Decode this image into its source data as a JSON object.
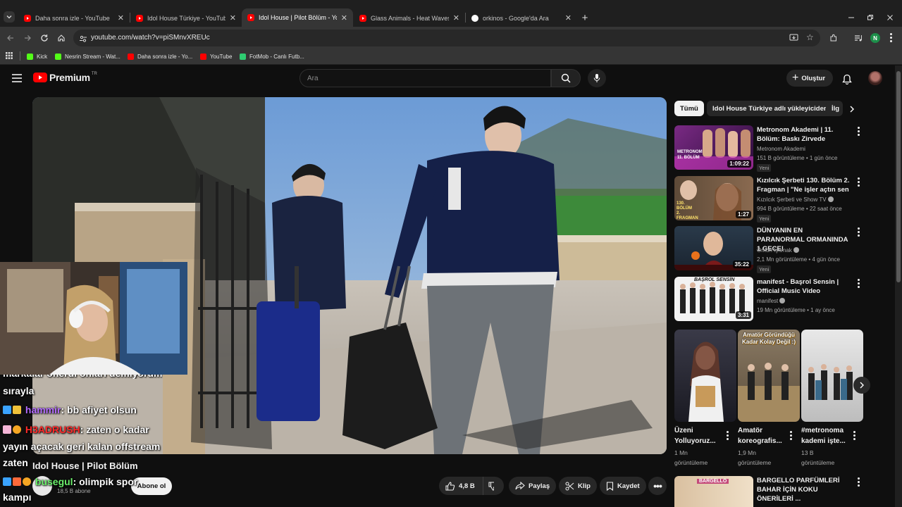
{
  "browser": {
    "tabs": [
      {
        "title": "Daha sonra izle - YouTube",
        "icon": "youtube-icon"
      },
      {
        "title": "Idol House Türkiye - YouTube",
        "icon": "youtube-icon"
      },
      {
        "title": "Idol House | Pilot Bölüm - YouT",
        "icon": "youtube-icon",
        "active": true
      },
      {
        "title": "Glass Animals - Heat Waves (Of",
        "icon": "youtube-icon"
      },
      {
        "title": "orkinos - Google'da Ara",
        "icon": "google-icon"
      }
    ],
    "url": "youtube.com/watch?v=piSMnvXREUc",
    "profile_initial": "N",
    "bookmarks": [
      {
        "label": "Kick",
        "color": "#53fc18"
      },
      {
        "label": "Nesrin Stream - Wat...",
        "color": "#53fc18"
      },
      {
        "label": "Daha sonra izle - Yo...",
        "color": "#ff0000"
      },
      {
        "label": "YouTube",
        "color": "#ff0000"
      },
      {
        "label": "FotMob - Canlı Futb...",
        "color": "#2ecc71"
      }
    ]
  },
  "youtube": {
    "logo_text": "Premium",
    "logo_sup": "TR",
    "search_placeholder": "Ara",
    "create_label": "Oluştur",
    "video": {
      "title": "Idol House | Pilot Bölüm",
      "channel_subs": "18,5 B abone",
      "subscribe_label": "Abone ol",
      "likes": "4,8 B",
      "share_label": "Paylaş",
      "clip_label": "Klip",
      "save_label": "Kaydet"
    },
    "chips": [
      "Tümü",
      "Idol House Türkiye adlı yükleyiciden",
      "İlg"
    ],
    "recommendations": [
      {
        "title": "Metronom Akademi | 11. Bölüm: Baskı Zirvede",
        "channel": "Metronom Akademi",
        "meta": "151 B görüntüleme • 1 gün önce",
        "badge": "Yeni",
        "duration": "1:09:22"
      },
      {
        "title": "Kızılcık Şerbeti 130. Bölüm 2. Fragman | \"Ne işler açtın sen ...",
        "channel": "Kızılcık Şerbeti ve Show TV",
        "meta": "994 B görüntüleme • 22 saat önce",
        "badge": "Yeni",
        "duration": "1:27"
      },
      {
        "title": "DÜNYANIN EN PARANORMAL ORMANINDA 1 GECE!",
        "channel": "Orkun Işıtmak",
        "meta": "2,1 Mn görüntüleme • 4 gün önce",
        "badge": "Yeni",
        "duration": "35:22"
      },
      {
        "title": "manifest - Başrol Sensin | Official Music Video",
        "channel": "manifest",
        "meta": "19 Mn görüntüleme • 1 ay önce",
        "badge": "",
        "duration": "3:31"
      },
      {
        "title": "BARGELLO PARFÜMLERİ BAHAR İÇİN KOKU ÖNERİLERİ ...",
        "channel": "",
        "meta": "",
        "badge": "",
        "duration": ""
      }
    ],
    "shorts": [
      {
        "title": "Üzeni Yolluyoruz...",
        "views": "1 Mn görüntüleme"
      },
      {
        "title": "Amatör koreografis...",
        "views": "1,9 Mn görüntüleme"
      },
      {
        "title": "#metronoma kademi işte...",
        "views": "13 B görüntüleme"
      }
    ],
    "thumb_texts": {
      "metronom": "METRONOM 11. BÖLÜM",
      "kizilcik": "130. BÖLÜM 2. FRAGMAN",
      "manifest": "BAŞROL SENSİN",
      "short2": "Amatör Göründüğü Kadar Kolay Değil :)",
      "bargello": "BARGELLO"
    }
  },
  "chat": [
    {
      "text": "markalar önerdi onları demiyorum",
      "color": "#ffffff"
    },
    {
      "text": "sırayla",
      "color": "#ffffff"
    },
    {
      "user": "hammir",
      "user_color": "#b36cff",
      "text": ": bb afiyet olsun"
    },
    {
      "user": "H3ADRUSH",
      "user_color": "#ff2a2a",
      "text": ": zaten o kadar"
    },
    {
      "text": "yayın açacak geri kalan offstream",
      "color": "#ffffff"
    },
    {
      "text": "zaten",
      "color": "#ffffff"
    },
    {
      "user": "busegul",
      "user_color": "#6cf06c",
      "text": ": olimpik spor"
    },
    {
      "text": "kampı",
      "color": "#ffffff"
    }
  ]
}
